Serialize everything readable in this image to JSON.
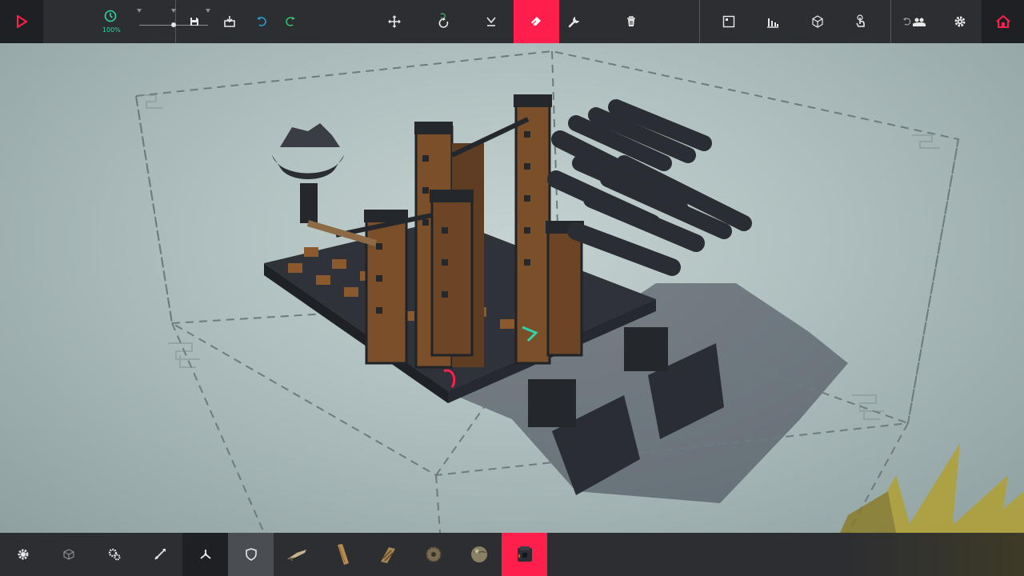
{
  "toolbar": {
    "time_scale": "100%",
    "icons": {
      "play": "play-icon",
      "clock": "clock-icon",
      "save": "save-icon",
      "load": "load-icon",
      "undo": "undo-icon",
      "redo": "redo-icon",
      "translate": "move-icon",
      "rotate": "rotate-icon",
      "flip": "flip-icon",
      "eraser": "eraser-icon",
      "wrench": "wrench-icon",
      "delete": "trash-icon",
      "info": "info-panel-icon",
      "stats": "stats-icon",
      "view": "cube-view-icon",
      "touch": "touch-icon",
      "multiplayer": "multiplayer-icon",
      "settings": "gear-icon",
      "home": "home-icon"
    },
    "colors": {
      "bar": "#2c2e31",
      "accent": "#ff1e4c",
      "time": "#2fd6a7",
      "undo": "#2aa0d8",
      "redo": "#36c46e"
    }
  },
  "bottom_toolbar": {
    "categories": [
      "basic-blocks",
      "blocks",
      "mechanical",
      "weaponry",
      "flight",
      "armour"
    ],
    "selected_category": "armour",
    "parts": [
      "wing",
      "wooden-plank",
      "armour-plate",
      "spinning-block",
      "ball",
      "armour-block"
    ],
    "selected_part": "armour-block"
  }
}
